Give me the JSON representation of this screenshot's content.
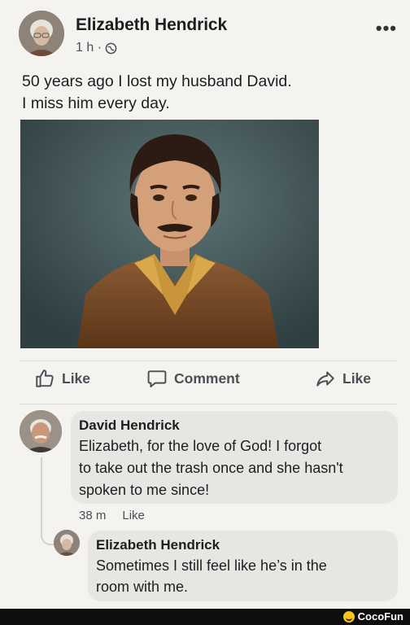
{
  "post": {
    "author": "Elizabeth Hendrick",
    "time": "1 h ·",
    "more_icon": "more-options-icon",
    "text_line1": "50 years ago I lost my husband David.",
    "text_line2": "I miss him every day."
  },
  "actions": {
    "like_label": "Like",
    "comment_label": "Comment",
    "share_label": "Like"
  },
  "comment": {
    "author": "David Hendrick",
    "line1": "Elizabeth, for the love of God! I forgot",
    "line2": "to take out the trash once and she hasn't",
    "line3": "spoken to me since!",
    "time": "38 m",
    "like_label": "Like"
  },
  "reply": {
    "author": "Elizabeth Hendrick",
    "line1": "Sometimes I still feel like he’s in the",
    "line2": "room with me."
  },
  "watermark": {
    "brand": "CocoFun"
  },
  "colors": {
    "background": "#f4f3ef",
    "bubble": "#e7e6e2",
    "text": "#1c1e21",
    "muted": "#4b4f56"
  }
}
